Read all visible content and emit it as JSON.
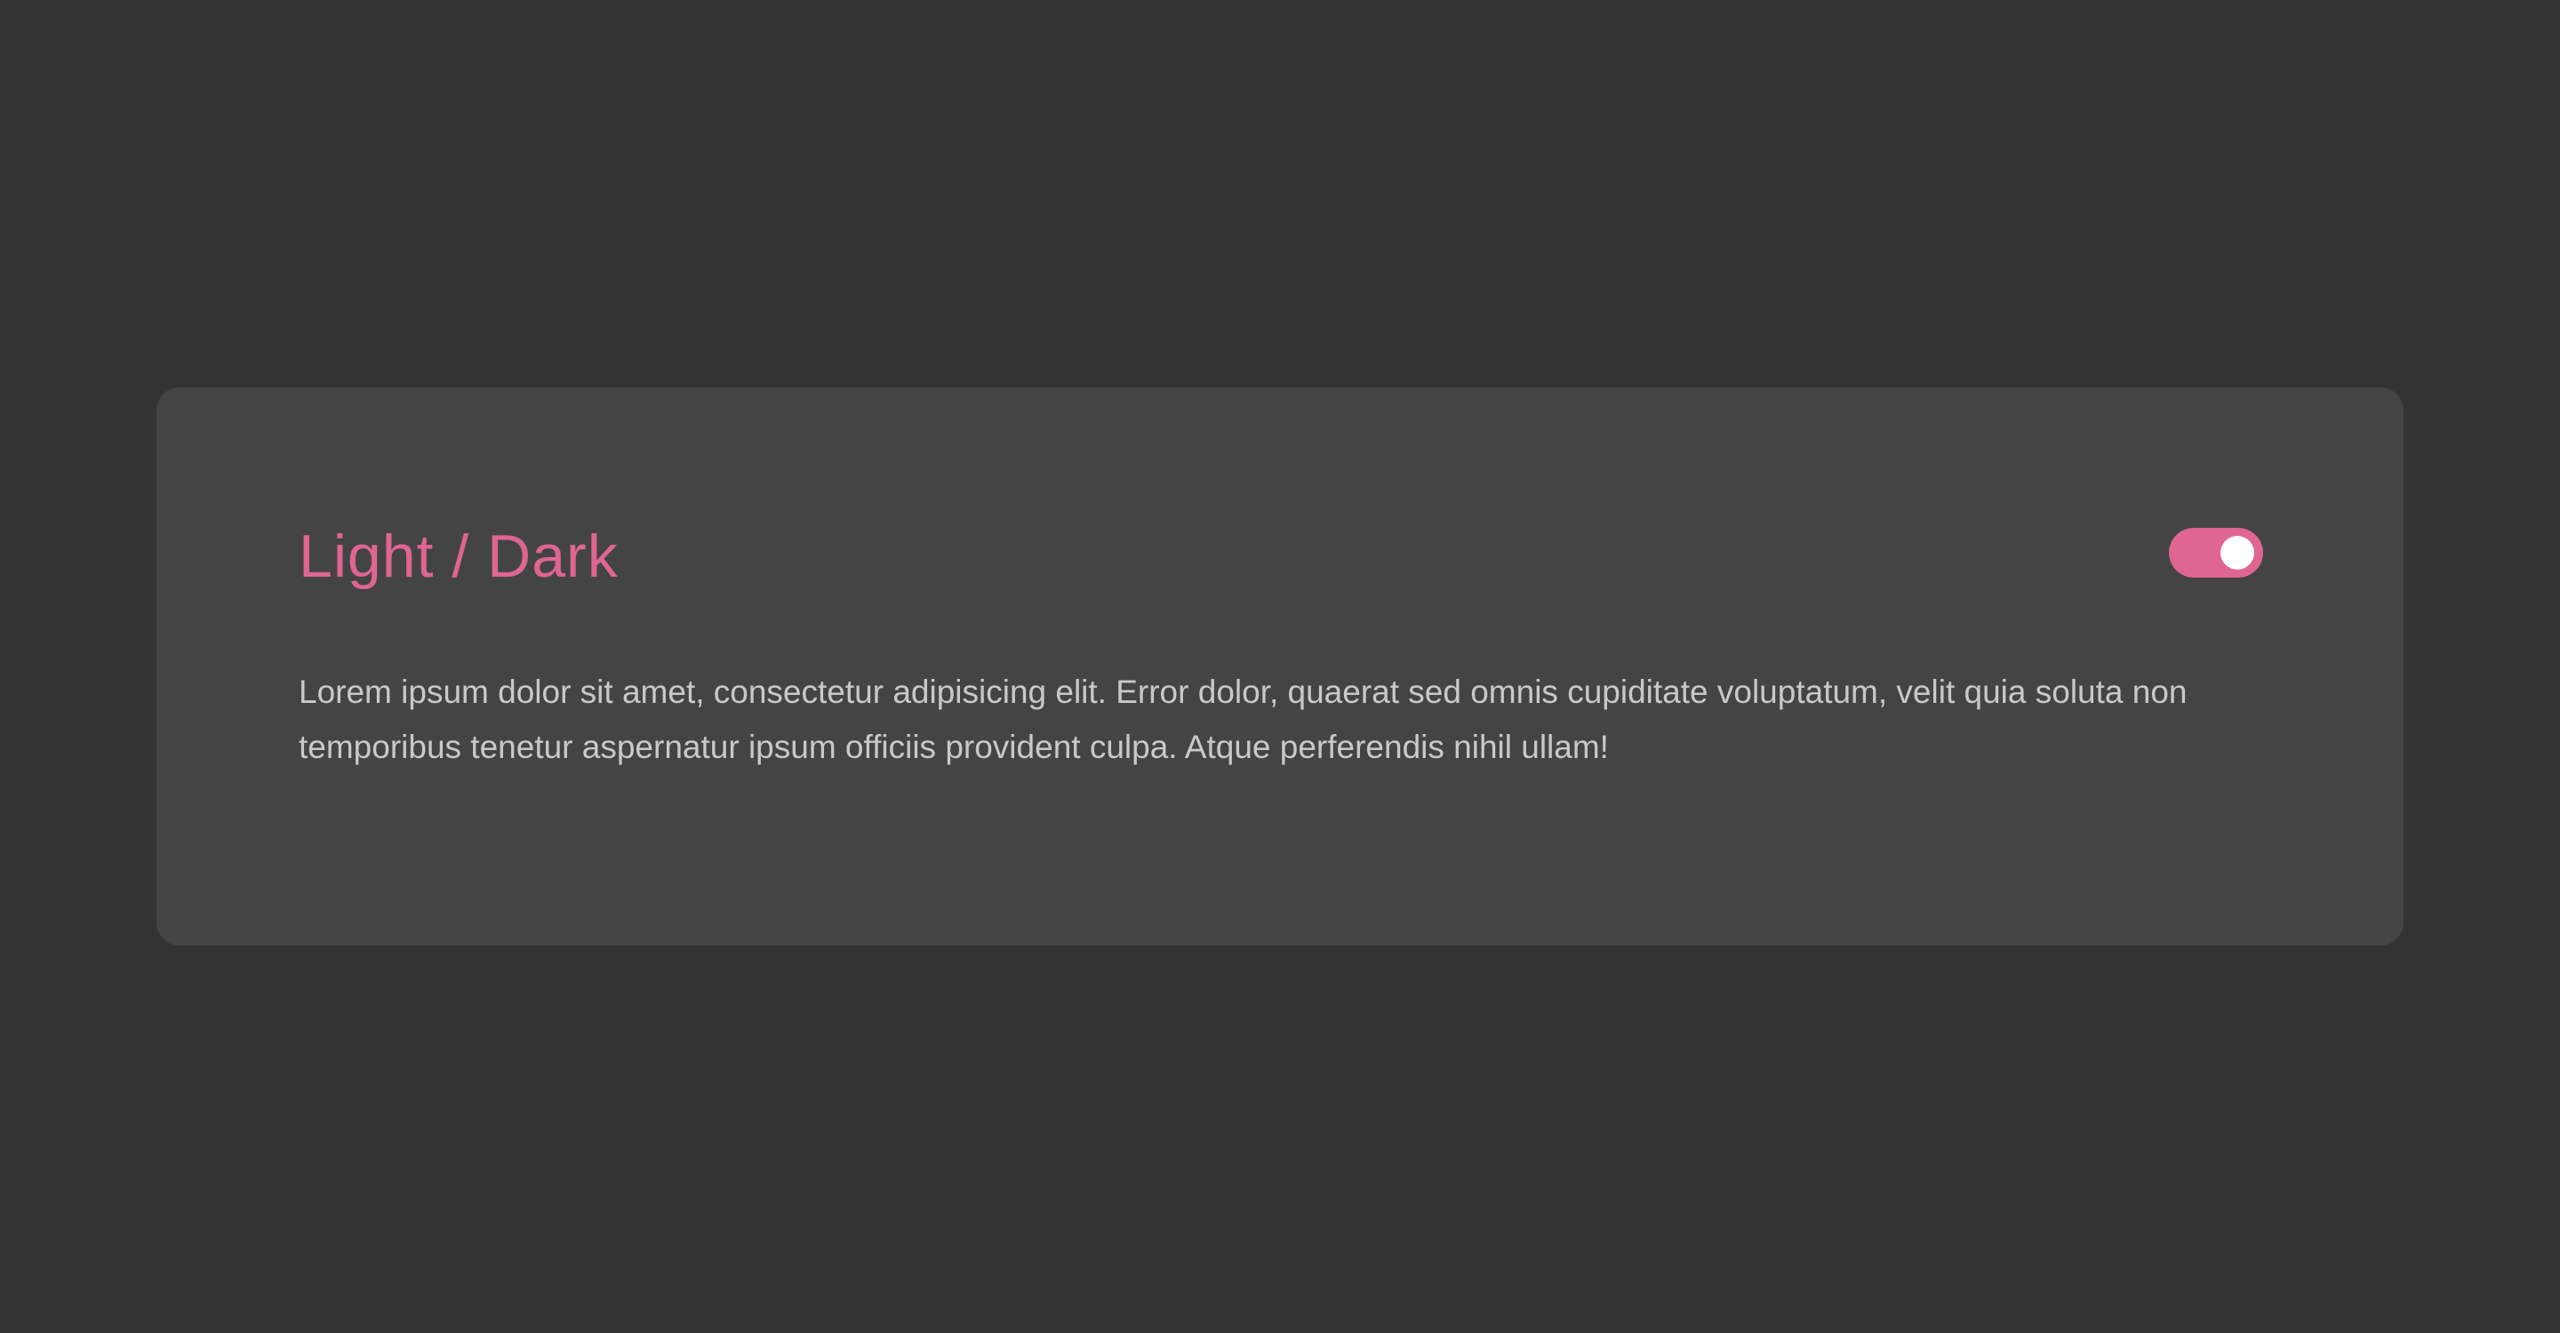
{
  "card": {
    "title": "Light / Dark",
    "body": "Lorem ipsum dolor sit amet, consectetur adipisicing elit. Error dolor, quaerat sed omnis cupiditate voluptatum, velit quia soluta non temporibus tenetur aspernatur ipsum officiis provident culpa. Atque perferendis nihil ullam!",
    "toggle": {
      "state": "on"
    }
  },
  "colors": {
    "background": "#333333",
    "card": "#444444",
    "accent": "#df6592",
    "text": "#c9c9c9",
    "knob": "#ffffff"
  }
}
